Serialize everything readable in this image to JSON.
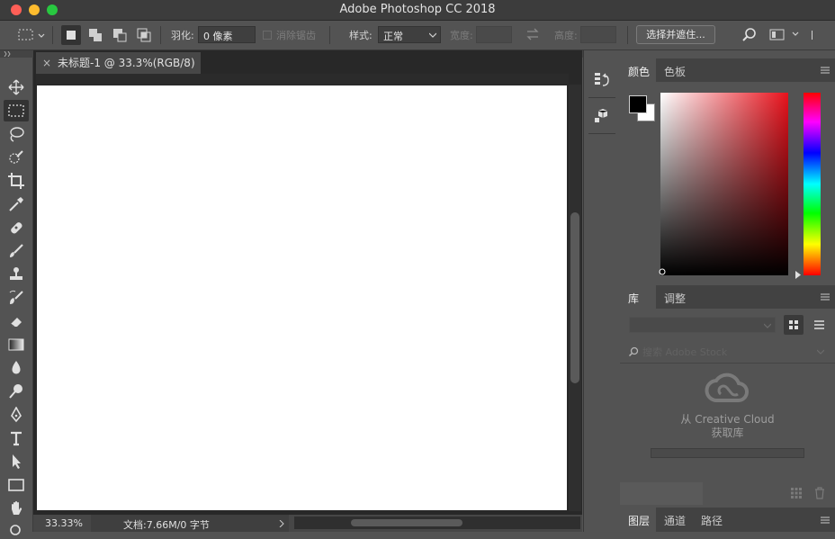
{
  "window": {
    "title": "Adobe Photoshop CC 2018",
    "traffic_colors": [
      "#ff5f57",
      "#febc2e",
      "#28c840"
    ]
  },
  "options_bar": {
    "feather_label": "羽化:",
    "feather_value": "0 像素",
    "antialias_label": "消除锯齿",
    "style_label": "样式:",
    "style_value": "正常",
    "width_label": "宽度:",
    "height_label": "高度:",
    "select_mask_button": "选择并遮住..."
  },
  "document": {
    "tab_close": "×",
    "tab_title": "未标题-1 @ 33.3%(RGB/8)",
    "zoom": "33.33%",
    "doc_info": "文档:7.66M/0 字节"
  },
  "color_panel": {
    "tabs": [
      "颜色",
      "色板"
    ],
    "foreground": "#000000",
    "background": "#ffffff",
    "hue_color": "#e8121c"
  },
  "library_panel": {
    "tabs": [
      "库",
      "调整"
    ],
    "search_placeholder": "搜索 Adobe Stock",
    "cc_line1": "从 Creative Cloud",
    "cc_line2": "获取库"
  },
  "layers_panel": {
    "tabs": [
      "图层",
      "通道",
      "路径"
    ]
  }
}
